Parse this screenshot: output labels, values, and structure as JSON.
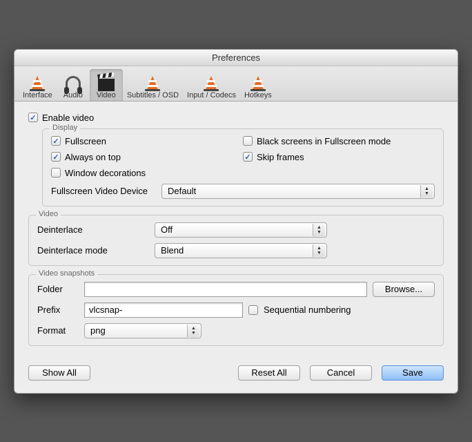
{
  "window_title": "Preferences",
  "tabs": [
    {
      "label": "Interface"
    },
    {
      "label": "Audio"
    },
    {
      "label": "Video"
    },
    {
      "label": "Subtitles / OSD"
    },
    {
      "label": "Input / Codecs"
    },
    {
      "label": "Hotkeys"
    }
  ],
  "enable_video_label": "Enable video",
  "enable_video_checked": true,
  "display": {
    "legend": "Display",
    "fullscreen_label": "Fullscreen",
    "fullscreen_checked": true,
    "black_screens_label": "Black screens in Fullscreen mode",
    "black_screens_checked": false,
    "always_on_top_label": "Always on top",
    "always_on_top_checked": true,
    "skip_frames_label": "Skip frames",
    "skip_frames_checked": true,
    "window_decorations_label": "Window decorations",
    "window_decorations_checked": false,
    "device_label": "Fullscreen Video Device",
    "device_value": "Default"
  },
  "video": {
    "legend": "Video",
    "deinterlace_label": "Deinterlace",
    "deinterlace_value": "Off",
    "mode_label": "Deinterlace mode",
    "mode_value": "Blend"
  },
  "snapshots": {
    "legend": "Video snapshots",
    "folder_label": "Folder",
    "folder_value": "",
    "browse_label": "Browse...",
    "prefix_label": "Prefix",
    "prefix_value": "vlcsnap-",
    "sequential_label": "Sequential numbering",
    "sequential_checked": false,
    "format_label": "Format",
    "format_value": "png"
  },
  "footer": {
    "show_all": "Show All",
    "reset_all": "Reset All",
    "cancel": "Cancel",
    "save": "Save"
  }
}
